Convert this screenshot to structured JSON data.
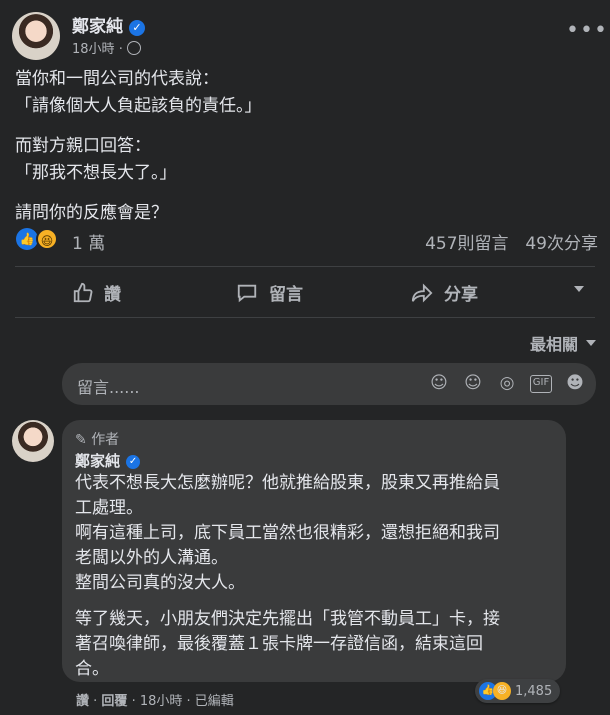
{
  "post": {
    "author": "鄭家純",
    "time": "18小時",
    "privacy_icon": "globe-icon",
    "paragraphs": [
      "當你和一間公司的代表說：",
      "「請像個大人負起該負的責任。」",
      "而對方親口回答：",
      "「那我不想長大了。」",
      "請問你的反應會是？"
    ]
  },
  "stats": {
    "reactions_count": "1 萬",
    "comments": "457則留言",
    "shares": "49次分享"
  },
  "actions": {
    "like": "讚",
    "comment": "留言",
    "share": "分享"
  },
  "sort": {
    "label": "最相關"
  },
  "comment_input": {
    "placeholder": "留言......"
  },
  "comment": {
    "badge": "作者",
    "author": "鄭家純",
    "lines": [
      "代表不想長大怎麼辦呢？他就推給股東，股東又再推給員",
      "工處理。",
      "啊有這種上司，底下員工當然也很精彩，還想拒絕和我司",
      "老闆以外的人溝通。",
      "整間公司真的沒大人。",
      "等了幾天，小朋友們決定先擺出「我管不動員工」卡，接",
      "著召喚律師，最後覆蓋１張卡牌一存證信函，結束這回",
      "合。"
    ],
    "like": "讚",
    "reply": "回覆",
    "time": "18小時",
    "edited": "已編輯",
    "reaction_count": "1,485"
  },
  "colors": {
    "background": "#242526",
    "bubble": "#3a3b3c",
    "accent_blue": "#1b74e4",
    "text": "#e4e6eb",
    "muted": "#b0b3b8"
  }
}
